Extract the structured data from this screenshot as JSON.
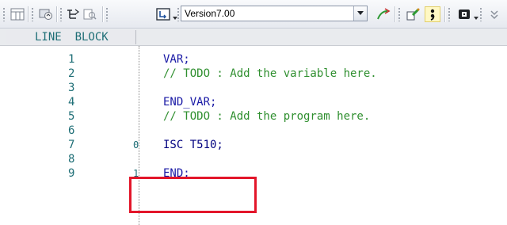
{
  "toolbar": {
    "buttons": [
      {
        "name": "grid-view-icon"
      },
      {
        "name": "monitor-device-icon"
      },
      {
        "name": "tree-view-icon"
      },
      {
        "name": "find-icon"
      },
      {
        "name": "insert-icon"
      },
      {
        "name": "arrow-up-icon"
      },
      {
        "name": "tool-color-icon"
      },
      {
        "name": "semicolon-icon"
      },
      {
        "name": "module-icon"
      }
    ],
    "version_select": {
      "value": "Version7.00"
    }
  },
  "editor": {
    "header_label": "LINE  BLOCK",
    "lines": [
      {
        "number": "1",
        "marker": "",
        "code": "VAR;",
        "type": "keyword"
      },
      {
        "number": "2",
        "marker": "",
        "code": "// TODO : Add the variable here.",
        "type": "comment"
      },
      {
        "number": "3",
        "marker": "",
        "code": "",
        "type": "plain"
      },
      {
        "number": "4",
        "marker": "",
        "code": "END_VAR;",
        "type": "keyword"
      },
      {
        "number": "5",
        "marker": "",
        "code": "// TODO : Add the program here.",
        "type": "comment"
      },
      {
        "number": "6",
        "marker": "",
        "code": "",
        "type": "plain"
      },
      {
        "number": "7",
        "marker": "0",
        "code": "ISC T510;",
        "type": "plain"
      },
      {
        "number": "8",
        "marker": "",
        "code": "",
        "type": "plain"
      },
      {
        "number": "9",
        "marker": "1",
        "code": "END;",
        "type": "keyword"
      }
    ]
  },
  "colors": {
    "highlight_box": "#e3162a",
    "line_number": "#1e6e76",
    "keyword": "#1a1aa6",
    "comment": "#2f8f2f"
  }
}
